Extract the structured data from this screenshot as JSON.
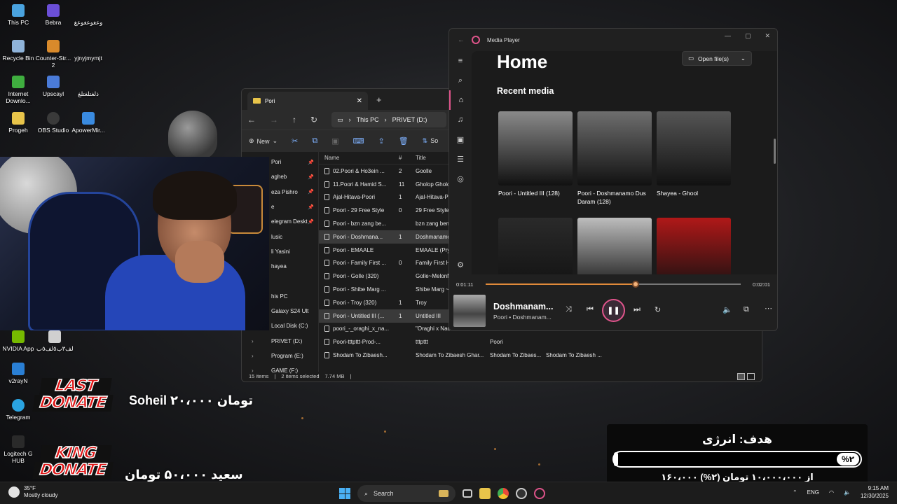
{
  "desktop": {
    "icons": [
      {
        "label": "This PC",
        "color": "#4aa3df"
      },
      {
        "label": "Bebra",
        "color": "#6b4fd8"
      },
      {
        "label": "وعغوعغوعغ",
        "color": "#ffffff"
      },
      {
        "label": "Recycle Bin",
        "color": "#8fb3d9"
      },
      {
        "label": "Counter-Str... 2",
        "color": "#d98a2b"
      },
      {
        "label": "yjnyjmymjt",
        "color": "#ffffff"
      },
      {
        "label": "Internet Downlo...",
        "color": "#3fae3f"
      },
      {
        "label": "Upscayl",
        "color": "#4a7bd8"
      },
      {
        "label": "ذلغتلغتلغ",
        "color": "#ffffff"
      },
      {
        "label": "Progeh",
        "color": "#e8c44a"
      },
      {
        "label": "OBS Studio",
        "color": "#3a3a3a"
      },
      {
        "label": "ApowerMir...",
        "color": "#3a8be0"
      },
      {
        "label": "NVIDIA App",
        "color": "#76b900"
      },
      {
        "label": "لف۳ب٥لف٥ب",
        "color": "#d0d0d0"
      },
      {
        "label": "v2rayN",
        "color": "#2a7fd4"
      },
      {
        "label": "Telegram",
        "color": "#2aa3e0"
      },
      {
        "label": "Logitech G HUB",
        "color": "#2a2a2a"
      }
    ]
  },
  "explorer": {
    "tab_title": "Pori",
    "address": {
      "root": "This PC",
      "drive": "PRIVET (D:)"
    },
    "commands": {
      "new": "New",
      "sort": "So"
    },
    "nav_items": [
      {
        "label": "Pori",
        "pinned": true
      },
      {
        "label": "agheb",
        "pinned": true
      },
      {
        "label": "eza Pishro",
        "pinned": true
      },
      {
        "label": "e",
        "pinned": true
      },
      {
        "label": "elegram Deskt",
        "pinned": true
      },
      {
        "label": "lusic",
        "pinned": false
      },
      {
        "label": "li Yasini",
        "pinned": false
      },
      {
        "label": "hayea",
        "pinned": false
      },
      {
        "label": "",
        "pinned": false
      },
      {
        "label": "his PC",
        "pinned": false
      },
      {
        "label": "Galaxy S24 Ult",
        "pinned": false
      },
      {
        "label": "Local Disk (C:)",
        "pinned": false
      },
      {
        "label": "PRIVET (D:)",
        "pinned": false,
        "chevron": true
      },
      {
        "label": "Program (E:)",
        "pinned": false,
        "chevron": true
      },
      {
        "label": "GAME (F:)",
        "pinned": false,
        "chevron": true
      }
    ],
    "columns": {
      "name": "Name",
      "num": "#",
      "title": "Title"
    },
    "files": [
      {
        "name": "02.Poori & Ho3ein ...",
        "num": "2",
        "title": "Goolle",
        "artist": "",
        "album": "",
        "selected": false
      },
      {
        "name": "11.Poori & Hamid S...",
        "num": "11",
        "title": "Gholop Gholop",
        "artist": "",
        "album": "",
        "selected": false
      },
      {
        "name": "Ajal-Hitava-Poori",
        "num": "1",
        "title": "Ajal-Hitava-Poo",
        "artist": "",
        "album": "",
        "selected": false
      },
      {
        "name": "Poori - 29 Free Style",
        "num": "0",
        "title": "29 Free Style",
        "artist": "",
        "album": "",
        "selected": false
      },
      {
        "name": "Poori - bzn zang be...",
        "num": "",
        "title": "bzn zang bem -",
        "artist": "",
        "album": "",
        "selected": false
      },
      {
        "name": "Poori - Doshmana...",
        "num": "1",
        "title": "Doshmanamo I",
        "artist": "",
        "album": "",
        "selected": true
      },
      {
        "name": "Poori - EMAALE",
        "num": "",
        "title": "EMAALE (Prym",
        "artist": "",
        "album": "",
        "selected": false
      },
      {
        "name": "Poori - Family First ...",
        "num": "0",
        "title": "Family First Ha",
        "artist": "",
        "album": "",
        "selected": false
      },
      {
        "name": "Poori - Golle (320)",
        "num": "",
        "title": "Golle~MelonM",
        "artist": "",
        "album": "",
        "selected": false
      },
      {
        "name": "Poori - Shibe Marg ...",
        "num": "",
        "title": "Shibe Marg ~ M",
        "artist": "",
        "album": "",
        "selected": false
      },
      {
        "name": "Poori - Troy (320)",
        "num": "1",
        "title": "Troy",
        "artist": "",
        "album": "",
        "selected": false
      },
      {
        "name": "Poori - Untitled III (...",
        "num": "1",
        "title": "Untitled III",
        "artist": "",
        "album": "",
        "selected": true
      },
      {
        "name": "poori_-_oraghi_x_na...",
        "num": "",
        "title": "\"Oraghi x Nada",
        "artist": "",
        "album": "",
        "selected": false
      },
      {
        "name": "Poori-tttpttt-Prod-...",
        "num": "",
        "title": "tttpttt",
        "artist": "Poori",
        "album": "",
        "selected": false
      },
      {
        "name": "Shodam To Zibaesh...",
        "num": "",
        "title": "Shodam To Zibaesh Ghar...",
        "artist": "Shodam To Zibaes...",
        "album": "Shodam To Zibaesh ...",
        "selected": false
      }
    ],
    "status": {
      "count": "15 items",
      "selected": "2 items selected",
      "size": "7.74 MB"
    }
  },
  "player": {
    "app_title": "Media Player",
    "heading": "Home",
    "open_label": "Open file(s)",
    "section": "Recent media",
    "cards": [
      {
        "label": "Poori - Untitled III (128)",
        "color": "#8a8a8a"
      },
      {
        "label": "Poori - Doshmanamo Dus Daram (128)",
        "color": "#6e6e6e"
      },
      {
        "label": "Shayea - Ghool",
        "color": "#555555"
      },
      {
        "label": "",
        "color": "#2a2a2a"
      },
      {
        "label": "",
        "color": "#bdbdbd"
      },
      {
        "label": "",
        "color": "#b01818"
      }
    ],
    "elapsed": "0:01:11",
    "total": "0:02:01",
    "progress": 0.587,
    "now_title": "Doshmanam...",
    "now_artist": "Poori • Doshmanam...",
    "accent": "#e0548b"
  },
  "overlay": {
    "last_donate": {
      "line1": "LAST",
      "line2": "DONATE",
      "text": "Soheil  ۲۰،۰۰۰ تومان"
    },
    "king_donate": {
      "line1": "KING",
      "line2": "DONATE",
      "text": "سعید  ۵۰،۰۰۰ تومان"
    },
    "goal": {
      "title": "هدف: انرژی",
      "percent_label": "%۲",
      "percent": 0.016,
      "amount": "۱۶۰،۰۰۰ از ۱۰،۰۰۰،۰۰۰ تومان (۲%)"
    }
  },
  "taskbar": {
    "weather_temp": "35°F",
    "weather_desc": "Mostly cloudy",
    "search": "Search",
    "lang": "ENG",
    "time": "9:15 AM",
    "date": "12/30/2025"
  }
}
